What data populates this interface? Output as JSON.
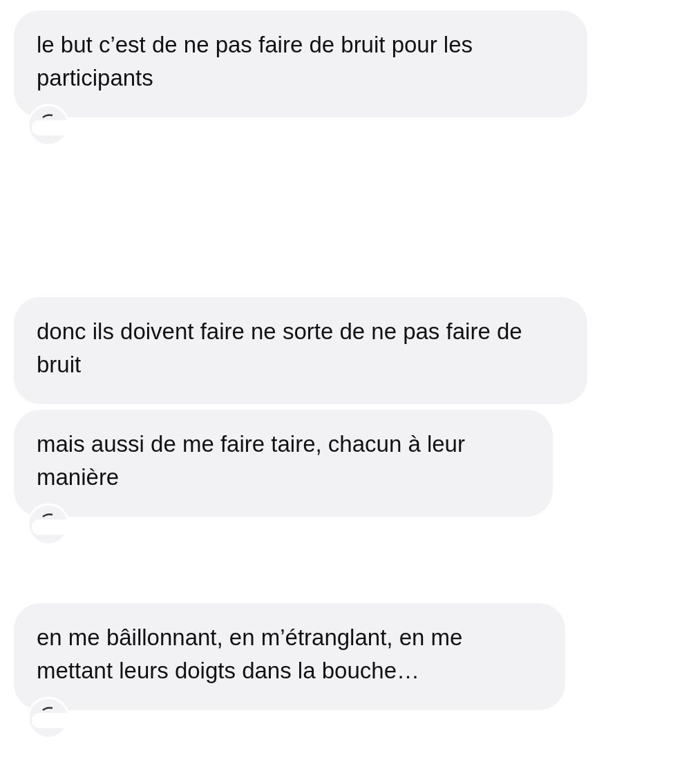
{
  "messages": [
    {
      "text": "le but c’est de ne pas faire de bruit pour les participants",
      "reaction": true
    },
    {
      "text": "donc ils doivent faire ne sorte de ne pas faire de bruit",
      "reaction": false
    },
    {
      "text": "mais aussi de me faire taire, chacun à leur manière",
      "reaction": true
    },
    {
      "text": "en me bâillonnant, en m’étranglant, en me mettant leurs doigts dans la bouche…",
      "reaction": true
    }
  ]
}
